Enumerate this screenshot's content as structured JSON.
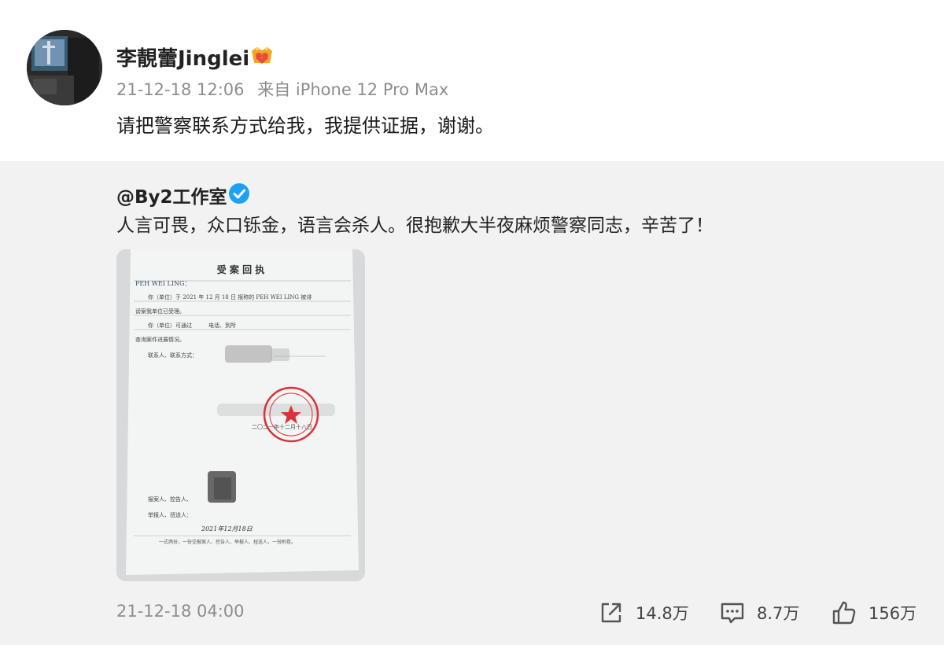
{
  "original_post": {
    "author": "李靚蕾Jinglei",
    "timestamp": "21-12-18 12:06",
    "source": "来自 iPhone 12 Pro Max",
    "text": "请把警察联系方式给我，我提供证据，谢谢。",
    "badge_icon": "crown-badge-icon"
  },
  "reposted_post": {
    "author": "@By2工作室",
    "verified_icon": "verified-check-icon",
    "text": "人言可畏，众口铄金，语言会杀人。很抱歉大半夜麻烦警察同志，辛苦了！",
    "image": {
      "title": "受 案 回 执",
      "recipient": "PEH WEI LING：",
      "line1": "你（单位）于 2021 年 12 月 18 日 报称的 PEH WEI LING 被诽",
      "line2": "谤案我单位已受理。",
      "line3": "你（单位）可通过　　　电话、到所",
      "line4": "查询案件进展情况。",
      "line5": "联系人、联系方式：",
      "date_line": "二〇二一年十二月十八日",
      "sig1": "报案人、控告人、",
      "sig2": "举报人、扭送人：",
      "sig_date": "2021年12月18日",
      "footnote": "一式两份，一份交报案人、控告人、举报人、扭送人，一份附卷。"
    },
    "timestamp": "21-12-18 04:00",
    "actions": {
      "repost_count": "14.8万",
      "comment_count": "8.7万",
      "like_count": "156万"
    }
  },
  "colors": {
    "repost_bg": "#f2f2f2",
    "meta_text": "#8d8d8d",
    "verified_blue": "#1da1f2",
    "badge_orange": "#f6a623",
    "stamp_red": "#d8323a"
  }
}
